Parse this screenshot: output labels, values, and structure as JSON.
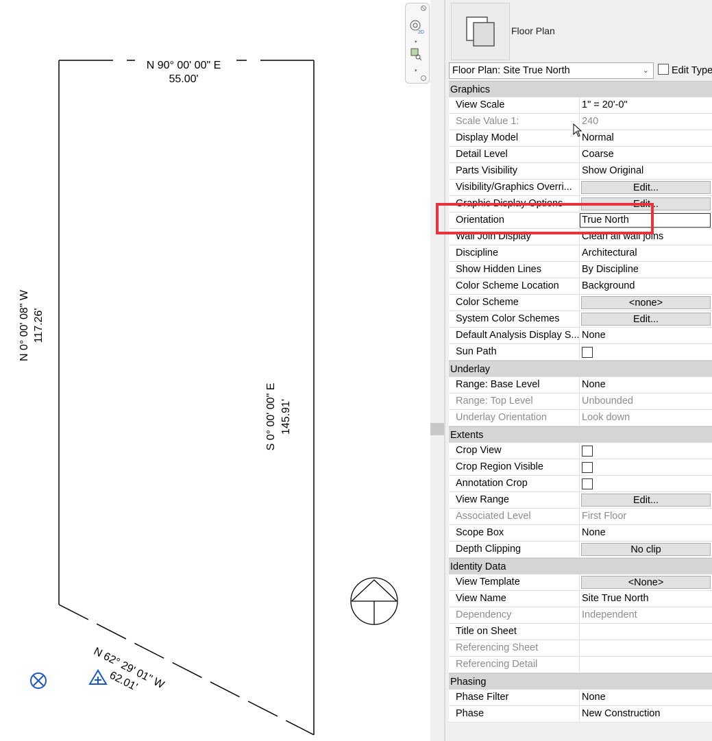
{
  "canvas": {
    "top_bearing": "N 90° 00' 00\" E",
    "top_length": "55.00'",
    "left_bearing": "N  0° 00' 08\" W",
    "left_length": "117.26'",
    "right_bearing": "S  0° 00' 00\" E",
    "right_length": "145.91'",
    "bottom_bearing": "N 62° 29' 01\" W",
    "bottom_length": "62.01'"
  },
  "nav": {
    "wheel_label": "2D"
  },
  "properties": {
    "type_name": "Floor Plan",
    "selector_value": "Floor Plan: Site True North",
    "edit_type_label": "Edit Type",
    "groups": [
      {
        "name": "Graphics",
        "rows": [
          {
            "label": "View Scale",
            "value": "1\" = 20'-0\""
          },
          {
            "label": "Scale Value    1:",
            "value": "240"
          },
          {
            "label": "Display Model",
            "value": "Normal"
          },
          {
            "label": "Detail Level",
            "value": "Coarse"
          },
          {
            "label": "Parts Visibility",
            "value": "Show Original"
          },
          {
            "label": "Visibility/Graphics Overri...",
            "value": "Edit..."
          },
          {
            "label": "Graphic Display Options",
            "value": "Edit..."
          },
          {
            "label": "Orientation",
            "value": "True North"
          },
          {
            "label": "Wall Join Display",
            "value": "Clean all wall joins"
          },
          {
            "label": "Discipline",
            "value": "Architectural"
          },
          {
            "label": "Show Hidden Lines",
            "value": "By Discipline"
          },
          {
            "label": "Color Scheme Location",
            "value": "Background"
          },
          {
            "label": "Color Scheme",
            "value": "<none>"
          },
          {
            "label": "System Color Schemes",
            "value": "Edit..."
          },
          {
            "label": "Default Analysis Display S...",
            "value": "None"
          },
          {
            "label": "Sun Path",
            "value": ""
          }
        ]
      },
      {
        "name": "Underlay",
        "rows": [
          {
            "label": "Range: Base Level",
            "value": "None"
          },
          {
            "label": "Range: Top Level",
            "value": "Unbounded"
          },
          {
            "label": "Underlay Orientation",
            "value": "Look down"
          }
        ]
      },
      {
        "name": "Extents",
        "rows": [
          {
            "label": "Crop View",
            "value": ""
          },
          {
            "label": "Crop Region Visible",
            "value": ""
          },
          {
            "label": "Annotation Crop",
            "value": ""
          },
          {
            "label": "View Range",
            "value": "Edit..."
          },
          {
            "label": "Associated Level",
            "value": "First Floor"
          },
          {
            "label": "Scope Box",
            "value": "None"
          },
          {
            "label": "Depth Clipping",
            "value": "No clip"
          }
        ]
      },
      {
        "name": "Identity Data",
        "rows": [
          {
            "label": "View Template",
            "value": "<None>"
          },
          {
            "label": "View Name",
            "value": "Site True North"
          },
          {
            "label": "Dependency",
            "value": "Independent"
          },
          {
            "label": "Title on Sheet",
            "value": ""
          },
          {
            "label": "Referencing Sheet",
            "value": ""
          },
          {
            "label": "Referencing Detail",
            "value": ""
          }
        ]
      },
      {
        "name": "Phasing",
        "rows": [
          {
            "label": "Phase Filter",
            "value": "None"
          },
          {
            "label": "Phase",
            "value": "New Construction"
          }
        ]
      }
    ]
  }
}
